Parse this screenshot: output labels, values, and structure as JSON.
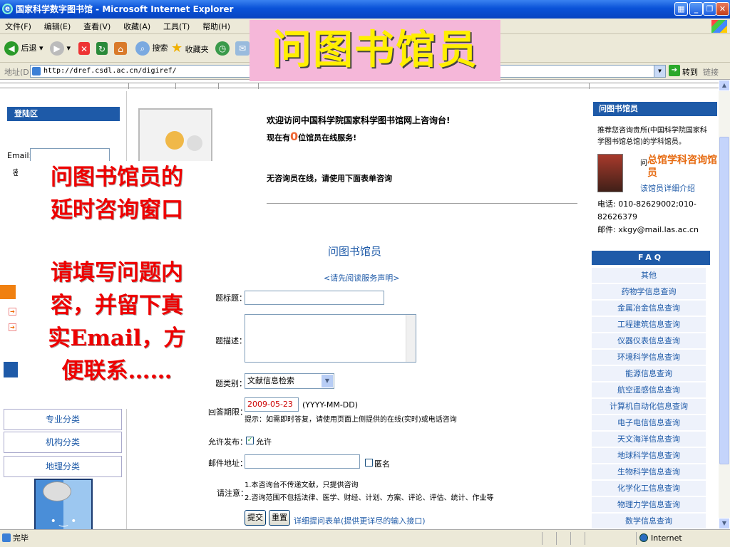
{
  "window": {
    "title": "国家科学数字图书馆 - Microsoft Internet Explorer"
  },
  "menu": [
    "文件(F)",
    "编辑(E)",
    "查看(V)",
    "收藏(A)",
    "工具(T)",
    "帮助(H)"
  ],
  "toolbar": {
    "back": "后退",
    "search": "搜索",
    "favorites": "收藏夹"
  },
  "address": {
    "label": "地址(D)",
    "url": "http://dref.csdl.ac.cn/digiref/",
    "go": "转到",
    "links": "链接"
  },
  "banner": {
    "text": "问图书馆员"
  },
  "left": {
    "login_header": "登陆区",
    "email_label": "Email:",
    "pw_label": "密",
    "categories": [
      "专业分类",
      "机构分类",
      "地理分类"
    ]
  },
  "center": {
    "welcome": "欢迎访问中国科学院国家科学图书馆网上咨询台!",
    "online_pre": "现在有",
    "online_count": "0",
    "online_post": "位馆员在线服务!",
    "no_librarian": "无咨询员在线，请使用下面表单咨询",
    "form_title": "问图书馆员",
    "read_notice": "<请先阅读服务声明>",
    "fields": {
      "subject_label": "题标题：",
      "desc_label": "题描述：",
      "category_label": "题类别：",
      "category_value": "文献信息检索",
      "deadline_label": "回答期限：",
      "deadline_value": "2009-05-23",
      "deadline_format": "(YYYY-MM-DD)",
      "deadline_hint": "提示：如需即时答复，请使用页面上侧提供的在线(实时)或电话咨询",
      "publish_label": "允许发布：",
      "publish_option": "允许",
      "email_label": "邮件地址：",
      "anonymous_label": "匿名",
      "notice_label": "请注意：",
      "notice_1": "1.本咨询台不传递文献，只提供咨询",
      "notice_2": "2.咨询范围不包括法律、医学、财经、计划、方案、评论、评估、统计、作业等"
    },
    "submit": "提交",
    "reset": "重置",
    "detail_link": "详细提问表单(提供更详尽的输入接口)"
  },
  "right": {
    "header": "问图书馆员",
    "recommend": "推荐您咨询贵所(中国科学院国家科学图书馆总馆)的学科馆员。",
    "ask_prefix": "问",
    "librarian_name": "总馆学科咨询馆员",
    "detail_link": "该馆员详细介绍",
    "phone": "电话: 010-82629002;010-82626379",
    "email": "邮件: xkgy@mail.las.ac.cn",
    "faq_header": "FAQ",
    "faq_items": [
      "其他",
      "药物学信息查询",
      "金属冶金信息查询",
      "工程建筑信息查询",
      "仪器仪表信息查询",
      "环境科学信息查询",
      "能源信息查询",
      "航空遥感信息查询",
      "计算机自动化信息查询",
      "电子电信信息查询",
      "天文海洋信息查询",
      "地球科学信息查询",
      "生物科学信息查询",
      "化学化工信息查询",
      "物理力学信息查询",
      "数学信息查询"
    ]
  },
  "overlay": {
    "line1": "问图书馆员的",
    "line2": "延时咨询窗口",
    "line3": "请填写问题内",
    "line4": "容，并留下真",
    "line5": "实Email，方",
    "line6": "便联系……"
  },
  "status": {
    "text": "完毕",
    "zone": "Internet"
  }
}
